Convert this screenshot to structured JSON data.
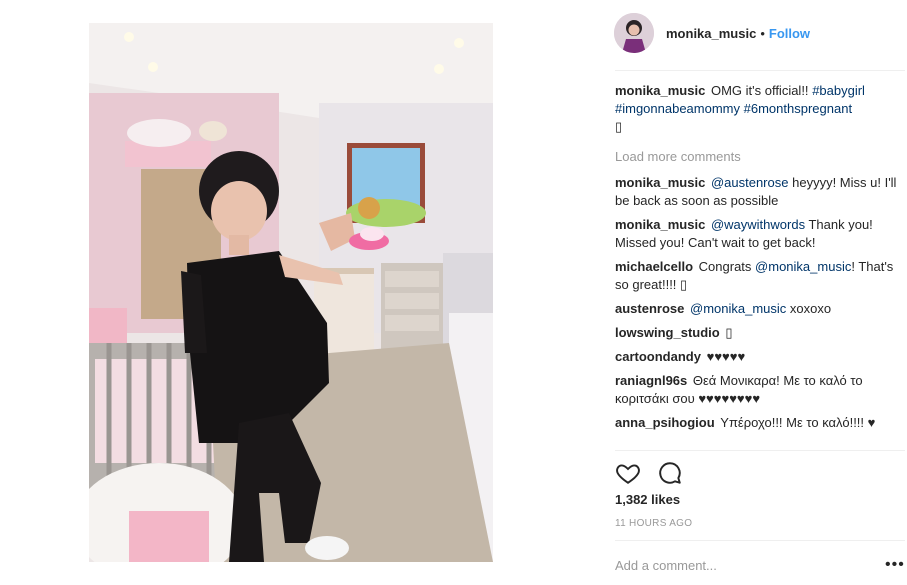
{
  "post": {
    "image_alt": "Woman in black outfit holding baby shoes in a nursery"
  },
  "header": {
    "username": "monika_music",
    "separator": "•",
    "follow_label": "Follow"
  },
  "caption": {
    "username": "monika_music",
    "text": "OMG it's official!!",
    "tag1": "#babygirl",
    "tag2": "#imgonnabeamommy",
    "tag3": "#6monthspregnant",
    "emoji": "▯"
  },
  "load_more": "Load more comments",
  "comments": [
    {
      "user": "monika_music",
      "mention": "@austenrose",
      "text": "heyyyy! Miss u! I'll be back as soon as possible"
    },
    {
      "user": "monika_music",
      "mention": "@waywithwords",
      "text": "Thank you! Missed you! Can't wait to get back!"
    },
    {
      "user": "michaelcello",
      "pre": "Congrats",
      "mention": "@monika_music",
      "text": "! That's so great!!!! ▯"
    },
    {
      "user": "austenrose",
      "mention": "@monika_music",
      "text": "xoxoxo"
    },
    {
      "user": "lowswing_studio",
      "text": "▯"
    },
    {
      "user": "cartoondandy",
      "text": "♥♥♥♥♥"
    },
    {
      "user": "raniagnl96s",
      "text": "Θεά Μονικαρα! Με το καλό το κοριτσάκι σου ♥♥♥♥♥♥♥♥"
    },
    {
      "user": "anna_psihogiou",
      "text": "Υπέροχο!!! Με το καλό!!!! ♥"
    }
  ],
  "likes": "1,382 likes",
  "time_ago": "11 HOURS AGO",
  "add_comment_placeholder": "Add a comment...",
  "more_icon": "•••"
}
